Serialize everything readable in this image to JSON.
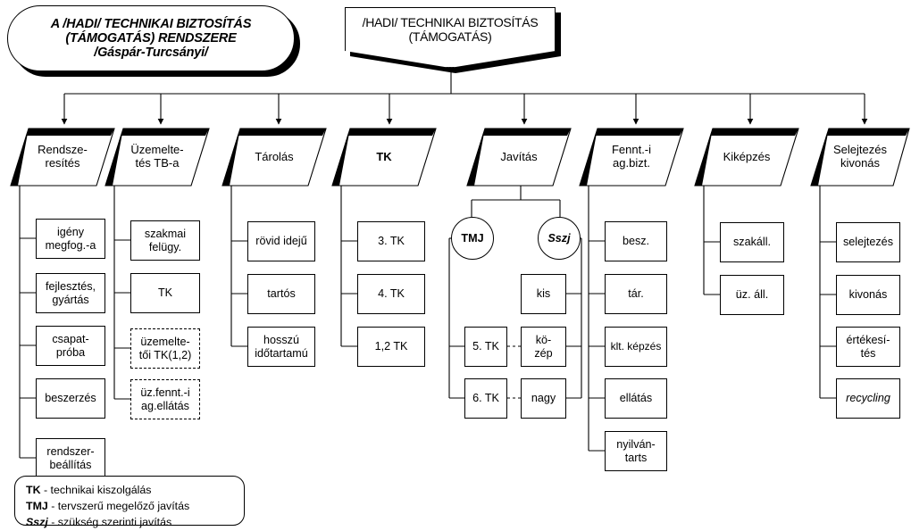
{
  "title_pill": {
    "line1": "A /HADI/ TECHNIKAI BIZTOSÍTÁS",
    "line2": "(TÁMOGATÁS) RENDSZERE",
    "line3": "/Gáspár-Turcsányi/"
  },
  "root": {
    "line1": "/HADI/ TECHNIKAI BIZTOSÍTÁS",
    "line2": "(TÁMOGATÁS)"
  },
  "branches": [
    {
      "id": "rendszeresites",
      "label_line1": "Rendsze-",
      "label_line2": "resítés",
      "bold": false
    },
    {
      "id": "uzemeltetes",
      "label_line1": "Üzemelte-",
      "label_line2": "tés TB-a",
      "bold": false
    },
    {
      "id": "tarolas",
      "label_line1": "Tárolás",
      "label_line2": "",
      "bold": false
    },
    {
      "id": "tk",
      "label_line1": "TK",
      "label_line2": "",
      "bold": true
    },
    {
      "id": "javitas",
      "label_line1": "Javítás",
      "label_line2": "",
      "bold": false
    },
    {
      "id": "fenntartas",
      "label_line1": "Fennt.-i",
      "label_line2": "ag.bizt.",
      "bold": false
    },
    {
      "id": "kikepzes",
      "label_line1": "Kiképzés",
      "label_line2": "",
      "bold": false
    },
    {
      "id": "selejtezes",
      "label_line1": "Selejtezés",
      "label_line2": "kivonás",
      "bold": false
    }
  ],
  "col_rendszeresites": [
    {
      "line1": "igény",
      "line2": "megfog.-a"
    },
    {
      "line1": "fejlesztés,",
      "line2": "gyártás"
    },
    {
      "line1": "csapat-",
      "line2": "próba"
    },
    {
      "line1": "beszerzés",
      "line2": ""
    },
    {
      "line1": "rendszer-",
      "line2": "beállítás"
    }
  ],
  "col_uzemeltetes": [
    {
      "line1": "szakmai",
      "line2": "felügy.",
      "dashed": false
    },
    {
      "line1": "TK",
      "line2": "",
      "dashed": false
    },
    {
      "line1": "üzemelte-",
      "line2": "tői TK(1,2)",
      "dashed": true
    },
    {
      "line1": "üz.fennt.-i",
      "line2": "ag.ellátás",
      "dashed": true
    }
  ],
  "col_tarolas": [
    {
      "line1": "rövid idejű",
      "line2": ""
    },
    {
      "line1": "tartós",
      "line2": ""
    },
    {
      "line1": "hosszú",
      "line2": "időtartamú"
    }
  ],
  "col_tk": [
    {
      "line1": "3. TK",
      "line2": ""
    },
    {
      "line1": "4. TK",
      "line2": ""
    },
    {
      "line1": "1,2 TK",
      "line2": ""
    }
  ],
  "col_javitas": {
    "node_tmj": "TMJ",
    "node_sszj": "Sszj",
    "tmj_items": [
      {
        "line1": "5. TK",
        "line2": ""
      },
      {
        "line1": "6. TK",
        "line2": ""
      }
    ],
    "sszj_items": [
      {
        "line1": "kis",
        "line2": ""
      },
      {
        "line1": "kö-",
        "line2": "zép"
      },
      {
        "line1": "nagy",
        "line2": ""
      }
    ]
  },
  "col_fenntartas": [
    {
      "line1": "besz.",
      "line2": ""
    },
    {
      "line1": "tár.",
      "line2": ""
    },
    {
      "line1": "klt. képzés",
      "line2": ""
    },
    {
      "line1": "ellátás",
      "line2": ""
    },
    {
      "line1": "nyilván-",
      "line2": "tarts"
    }
  ],
  "col_kikepzes": [
    {
      "line1": "szakáll.",
      "line2": ""
    },
    {
      "line1": "üz. áll.",
      "line2": ""
    }
  ],
  "col_selejtezes": [
    {
      "line1": "selejtezés",
      "line2": "",
      "italic": false
    },
    {
      "line1": "kivonás",
      "line2": "",
      "italic": false
    },
    {
      "line1": "értékesí-",
      "line2": "tés",
      "italic": false
    },
    {
      "line1": "recycling",
      "line2": "",
      "italic": true
    }
  ],
  "legend": [
    {
      "abbr": "TK",
      "italic": false,
      "text": " - technikai kiszolgálás"
    },
    {
      "abbr": "TMJ",
      "italic": false,
      "text": " - tervszerű megelőző javítás"
    },
    {
      "abbr": "Sszj",
      "italic": true,
      "text": " - szükség szerinti javítás"
    }
  ],
  "colors": {
    "ink": "#000000",
    "paper": "#ffffff"
  }
}
